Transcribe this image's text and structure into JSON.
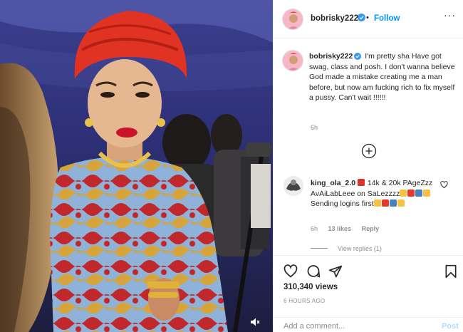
{
  "colors": {
    "link_blue": "#0095f6",
    "muted": "#8e8e8e",
    "text": "#262626",
    "post_disabled": "#b3dbff"
  },
  "header": {
    "username": "bobrisky222",
    "follow_label": "Follow",
    "more_label": "···",
    "avatar_icon": "profile-avatar",
    "verified_icon": "verified-badge-icon"
  },
  "caption": {
    "username": "bobrisky222",
    "text": "I'm pretty sha Have got swag, class and posh. I don't wanna believe God made a mistake creating me a man before, but now am fucking rich to fix myself a pussy. Can't wait !!!!!!",
    "time": "6h"
  },
  "load_more_icon": "plus-circle-icon",
  "comment": {
    "username": "king_ola_2.0",
    "text_part1": " 14k & 20k PAgeZzz AvAiLabLeee on SaLezzzz",
    "text_part2": "Sending logins first",
    "time": "6h",
    "likes": "13 likes",
    "reply_label": "Reply",
    "view_replies": "View replies (1)"
  },
  "actions": {
    "views": "310,340 views",
    "time_ago": "6 HOURS AGO",
    "comment_placeholder": "Add a comment...",
    "post_label": "Post"
  },
  "video": {
    "mute_icon": "speaker-muted-icon"
  }
}
